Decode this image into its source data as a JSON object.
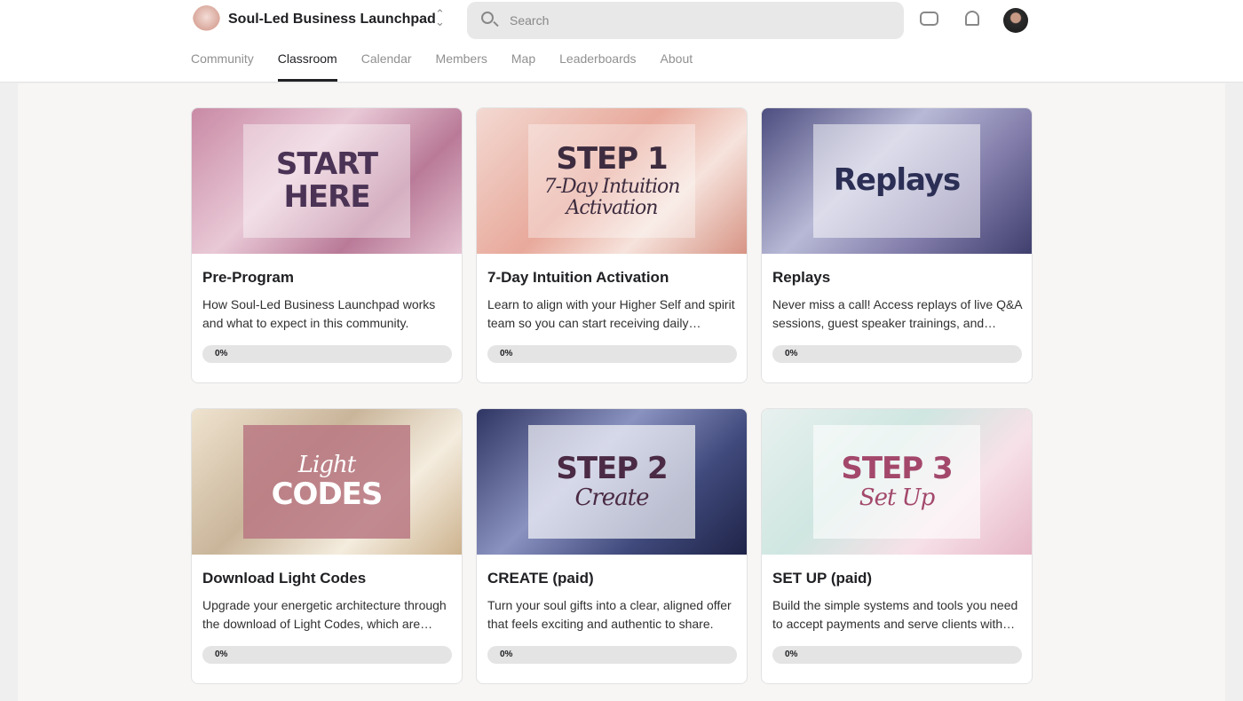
{
  "header": {
    "community_name": "Soul-Led Business Launchpad",
    "search_placeholder": "Search"
  },
  "tabs": [
    "Community",
    "Classroom",
    "Calendar",
    "Members",
    "Map",
    "Leaderboards",
    "About"
  ],
  "active_tab": "Classroom",
  "courses": [
    {
      "title": "Pre-Program",
      "description": "How Soul-Led Business Launchpad works and what to expect in this community.",
      "progress": "0%",
      "thumb_line1": "START HERE",
      "thumb_line2": ""
    },
    {
      "title": "7-Day Intuition Activation",
      "description": "Learn to align with your Higher Self and spirit team so you can start receiving daily…",
      "progress": "0%",
      "thumb_line1": "STEP 1",
      "thumb_line2": "7-Day Intuition Activation"
    },
    {
      "title": "Replays",
      "description": "Never miss a call! Access replays of live Q&A sessions, guest speaker trainings, and…",
      "progress": "0%",
      "thumb_line1": "Replays",
      "thumb_line2": ""
    },
    {
      "title": "Download Light Codes",
      "description": "Upgrade your energetic architecture through the download of Light Codes, which are…",
      "progress": "0%",
      "thumb_line1": "CODES",
      "thumb_line2": "Light"
    },
    {
      "title": "CREATE (paid)",
      "description": "Turn your soul gifts into a clear, aligned offer that feels exciting and authentic to share.",
      "progress": "0%",
      "thumb_line1": "STEP 2",
      "thumb_line2": "Create"
    },
    {
      "title": "SET UP (paid)",
      "description": "Build the simple systems and tools you need to accept payments and serve clients with…",
      "progress": "0%",
      "thumb_line1": "STEP 3",
      "thumb_line2": "Set Up"
    }
  ]
}
